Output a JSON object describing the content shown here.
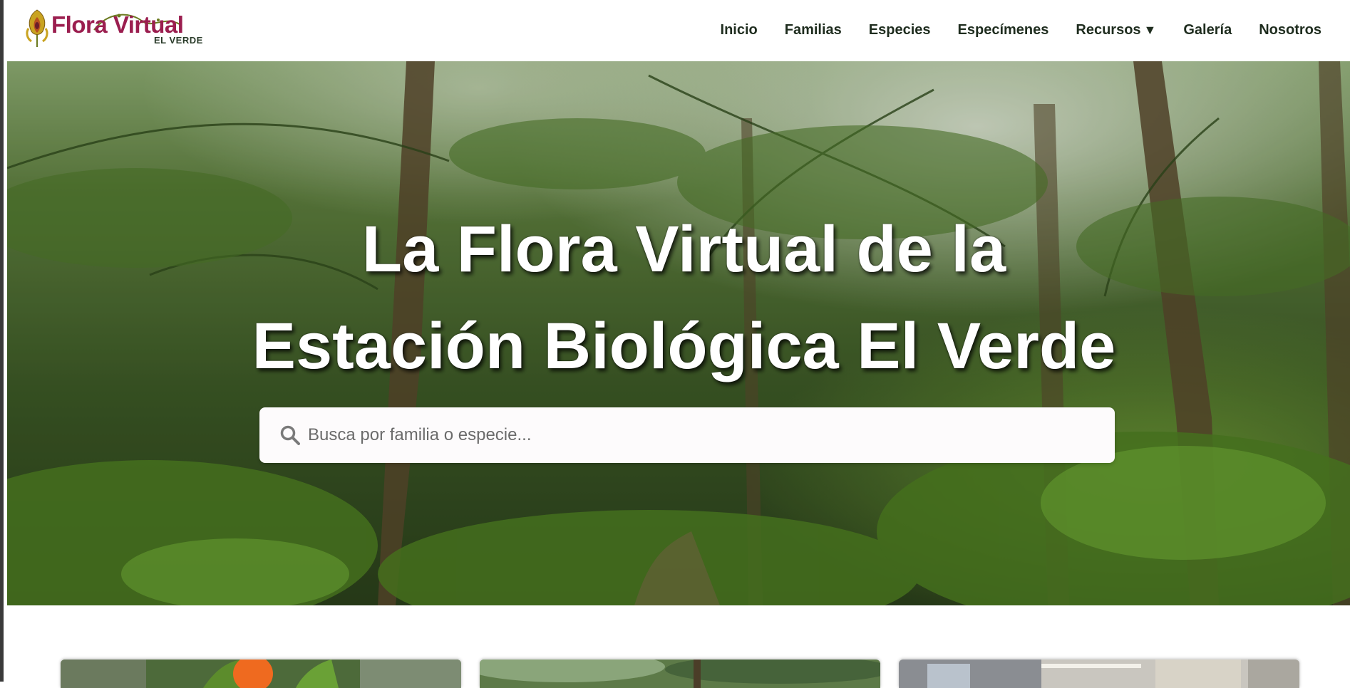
{
  "brand": {
    "title": "Flora Virtual",
    "subtitle": "EL VERDE"
  },
  "nav": {
    "items": [
      {
        "label": "Inicio"
      },
      {
        "label": "Familias"
      },
      {
        "label": "Especies"
      },
      {
        "label": "Especímenes"
      },
      {
        "label": "Recursos",
        "caret": "▼"
      },
      {
        "label": "Galería"
      },
      {
        "label": "Nosotros"
      }
    ]
  },
  "hero": {
    "title_line1": "La Flora Virtual de la",
    "title_line2": "Estación Biológica El Verde"
  },
  "search": {
    "placeholder": "Busca por familia o especie...",
    "icon": "search-icon"
  },
  "colors": {
    "brand": "#9b1e4f",
    "nav_text": "#1f2d1f",
    "hero_text": "#ffffff"
  }
}
